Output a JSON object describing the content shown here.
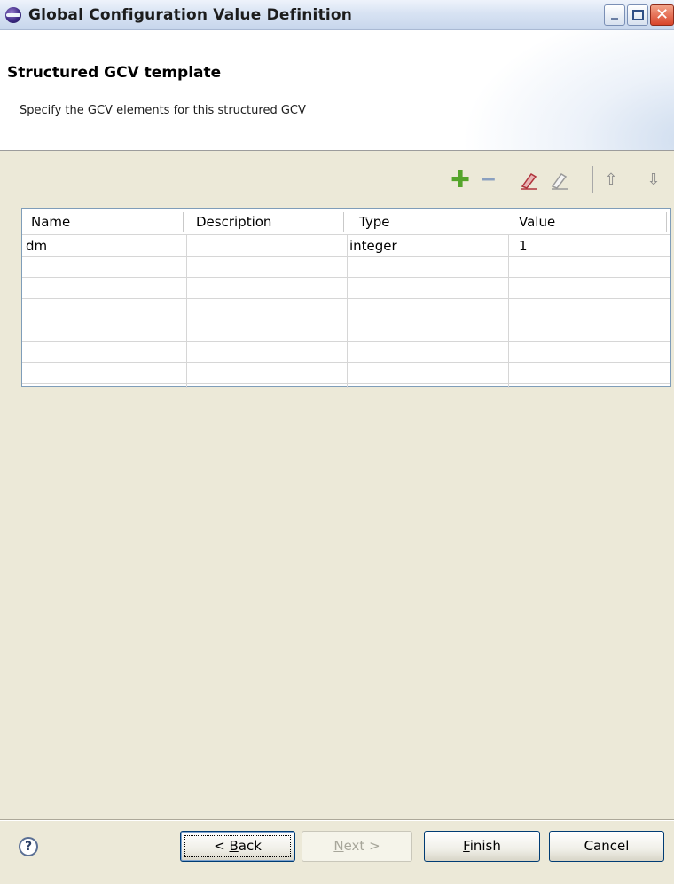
{
  "window": {
    "title": "Global Configuration Value Definition"
  },
  "header": {
    "title": "Structured GCV template",
    "description": "Specify the GCV elements for this structured GCV"
  },
  "toolbar": {
    "add_icon": "plus-icon",
    "remove_icon": "minus-icon",
    "edit_icon": "eraser-icon",
    "edit_disabled_icon": "pencil-icon",
    "up_icon": "arrow-up-icon",
    "down_icon": "arrow-down-icon"
  },
  "table": {
    "columns": [
      "Name",
      "Description",
      "Type",
      "Value"
    ],
    "rows": [
      {
        "name": "dm",
        "description": "",
        "type": "integer",
        "value": "1"
      }
    ]
  },
  "footer": {
    "help": "?",
    "back_prefix": "< ",
    "back_key": "B",
    "back_rest": "ack",
    "next_key": "N",
    "next_rest": "ext >",
    "finish_key": "F",
    "finish_rest": "inish",
    "cancel": "Cancel"
  },
  "colors": {
    "accent": "#003c74",
    "add_green": "#55a52b"
  }
}
